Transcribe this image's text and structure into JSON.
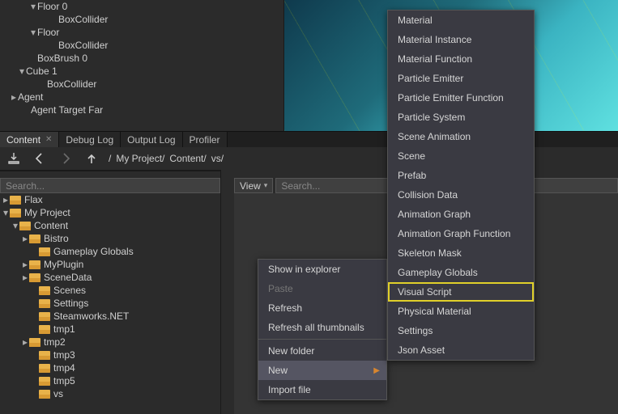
{
  "scene_hierarchy": [
    {
      "indent": 36,
      "tri": "▾",
      "label": "Floor 0"
    },
    {
      "indent": 62,
      "tri": "",
      "label": "BoxCollider"
    },
    {
      "indent": 36,
      "tri": "▾",
      "label": "Floor"
    },
    {
      "indent": 62,
      "tri": "",
      "label": "BoxCollider"
    },
    {
      "indent": 36,
      "tri": "",
      "label": "BoxBrush 0"
    },
    {
      "indent": 22,
      "tri": "▾",
      "label": "Cube 1"
    },
    {
      "indent": 48,
      "tri": "",
      "label": "BoxCollider"
    },
    {
      "indent": 12,
      "tri": "▸",
      "label": "Agent"
    },
    {
      "indent": 28,
      "tri": "",
      "label": "Agent Target Far"
    }
  ],
  "tabs": [
    {
      "label": "Content",
      "active": true,
      "closable": true
    },
    {
      "label": "Debug Log",
      "active": false
    },
    {
      "label": "Output Log",
      "active": false
    },
    {
      "label": "Profiler",
      "active": false
    }
  ],
  "breadcrumb": [
    "/",
    "My Project/",
    "Content/",
    "vs/"
  ],
  "left_search_placeholder": "Search...",
  "right_search_placeholder": "Search...",
  "view_button": "View",
  "left_tree": [
    {
      "indent": 2,
      "tri": "▸",
      "label": "Flax"
    },
    {
      "indent": 2,
      "tri": "▾",
      "label": "My Project"
    },
    {
      "indent": 14,
      "tri": "▾",
      "label": "Content"
    },
    {
      "indent": 26,
      "tri": "▸",
      "label": "Bistro"
    },
    {
      "indent": 38,
      "tri": "",
      "label": "Gameplay Globals"
    },
    {
      "indent": 26,
      "tri": "▸",
      "label": "MyPlugin"
    },
    {
      "indent": 26,
      "tri": "▸",
      "label": "SceneData"
    },
    {
      "indent": 38,
      "tri": "",
      "label": "Scenes"
    },
    {
      "indent": 38,
      "tri": "",
      "label": "Settings"
    },
    {
      "indent": 38,
      "tri": "",
      "label": "Steamworks.NET"
    },
    {
      "indent": 38,
      "tri": "",
      "label": "tmp1"
    },
    {
      "indent": 26,
      "tri": "▸",
      "label": "tmp2"
    },
    {
      "indent": 38,
      "tri": "",
      "label": "tmp3"
    },
    {
      "indent": 38,
      "tri": "",
      "label": "tmp4"
    },
    {
      "indent": 38,
      "tri": "",
      "label": "tmp5"
    },
    {
      "indent": 38,
      "tri": "",
      "label": "vs"
    }
  ],
  "ctx1": [
    {
      "label": "Show in explorer",
      "type": "item"
    },
    {
      "label": "Paste",
      "type": "disabled"
    },
    {
      "label": "Refresh",
      "type": "item"
    },
    {
      "label": "Refresh all thumbnails",
      "type": "item"
    },
    {
      "type": "sep"
    },
    {
      "label": "New folder",
      "type": "item"
    },
    {
      "label": "New",
      "type": "item-hover",
      "arrow": true
    },
    {
      "label": "Import file",
      "type": "item"
    }
  ],
  "ctx2": [
    {
      "label": "Material"
    },
    {
      "label": "Material Instance"
    },
    {
      "label": "Material Function"
    },
    {
      "label": "Particle Emitter"
    },
    {
      "label": "Particle Emitter Function"
    },
    {
      "label": "Particle System"
    },
    {
      "label": "Scene Animation"
    },
    {
      "label": "Scene"
    },
    {
      "label": "Prefab"
    },
    {
      "label": "Collision Data"
    },
    {
      "label": "Animation Graph"
    },
    {
      "label": "Animation Graph Function"
    },
    {
      "label": "Skeleton Mask"
    },
    {
      "label": "Gameplay Globals"
    },
    {
      "label": "Visual Script",
      "highlight": true
    },
    {
      "label": "Physical Material"
    },
    {
      "label": "Settings"
    },
    {
      "label": "Json Asset"
    }
  ]
}
